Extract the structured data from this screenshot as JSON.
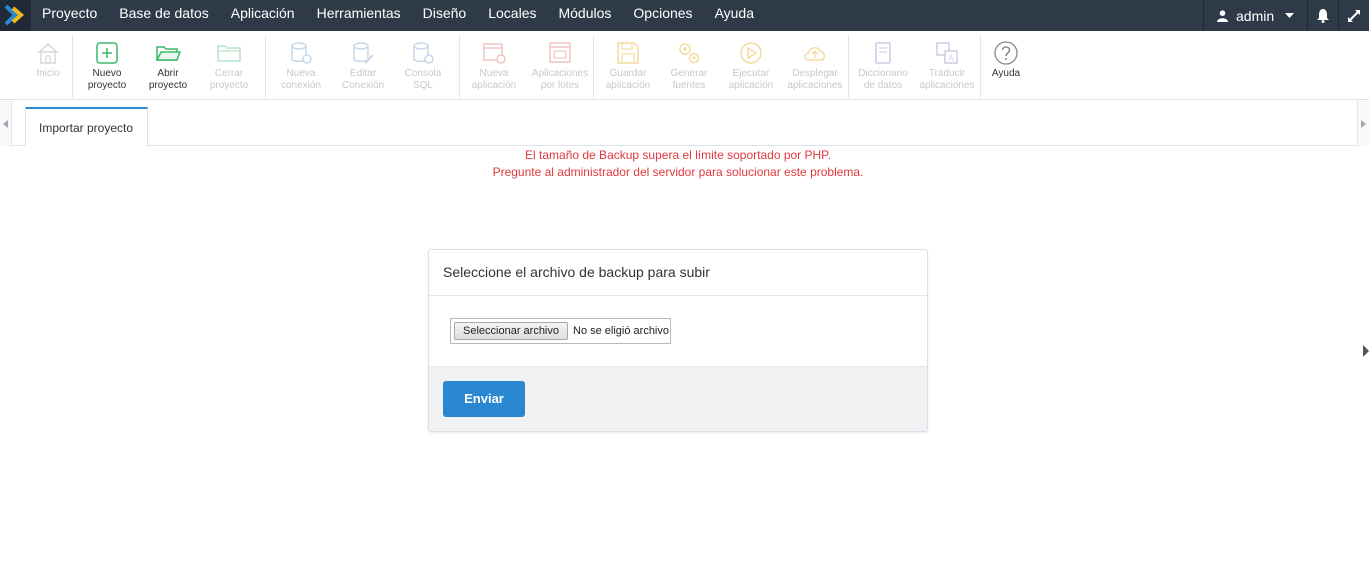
{
  "menubar": {
    "items": [
      "Proyecto",
      "Base de datos",
      "Aplicación",
      "Herramientas",
      "Diseño",
      "Locales",
      "Módulos",
      "Opciones",
      "Ayuda"
    ],
    "user": "admin",
    "icons": [
      "user-icon",
      "caret-down-icon",
      "bell-icon",
      "expand-icon"
    ]
  },
  "toolbar": {
    "items": [
      {
        "label": "Inicio",
        "icon": "home-icon"
      },
      {
        "label": "Nuevo\nproyecto",
        "icon": "plus-square-icon"
      },
      {
        "label": "Abrir\nproyecto",
        "icon": "folder-open-icon"
      },
      {
        "label": "Cerrar\nproyecto",
        "icon": "folder-icon"
      },
      {
        "label": "Nueva\nconexión",
        "icon": "database-add-icon"
      },
      {
        "label": "Editar\nConexión",
        "icon": "database-edit-icon"
      },
      {
        "label": "Consola\nSQL",
        "icon": "database-console-icon"
      },
      {
        "label": "Nueva\naplicación",
        "icon": "app-add-icon"
      },
      {
        "label": "Aplicaciones\npor lotes",
        "icon": "app-batch-icon"
      },
      {
        "label": "Guardar\naplicación",
        "icon": "save-icon"
      },
      {
        "label": "Generar\nfuentes",
        "icon": "gears-icon"
      },
      {
        "label": "Ejecutar\naplicación",
        "icon": "play-icon"
      },
      {
        "label": "Desplegar\naplicaciones",
        "icon": "cloud-upload-icon"
      },
      {
        "label": "Diccionario\nde datos",
        "icon": "book-icon"
      },
      {
        "label": "Traducir\naplicaciones",
        "icon": "translate-icon"
      },
      {
        "label": "Ayuda",
        "icon": "help-icon"
      }
    ]
  },
  "tabs": [
    {
      "label": "Importar proyecto",
      "active": true
    }
  ],
  "errors": {
    "line1": "El tamaño de Backup supera el límite soportado por PHP.",
    "line2": "Pregunte al administrador del servidor para solucionar este problema.",
    "color": "#e0383e"
  },
  "panel": {
    "title": "Seleccione el archivo de backup para subir",
    "file_button": "Seleccionar archivo",
    "file_status": "No se eligió archivo",
    "submit_label": "Enviar"
  },
  "colors": {
    "menubar_bg": "#2e3a47",
    "accent": "#2a88d2",
    "logo_yellow": "#f5b81c",
    "logo_blue": "#2a88d2"
  }
}
